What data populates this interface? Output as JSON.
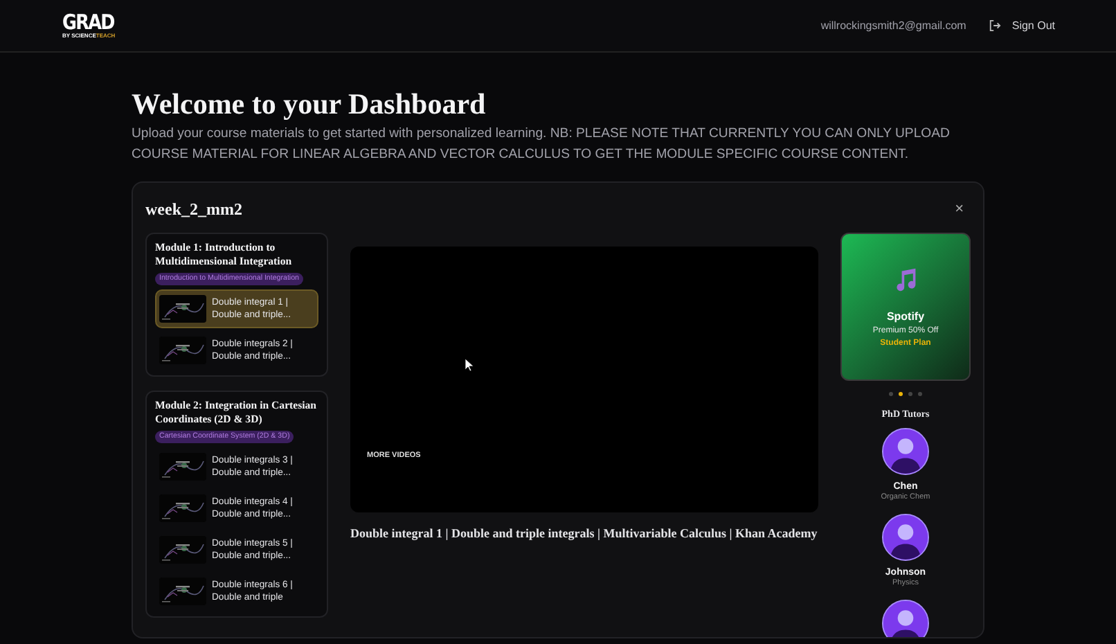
{
  "header": {
    "logo": "GRAD",
    "logo_sub_a": "BY SCIENCE",
    "logo_sub_b": "TEACH",
    "email": "willrockingsmith2@gmail.com",
    "sign_out": "Sign Out"
  },
  "page": {
    "title": "Welcome to your Dashboard",
    "description": "Upload your course materials to get started with personalized learning. NB: PLEASE NOTE THAT CURRENTLY YOU CAN ONLY UPLOAD COURSE MATERIAL FOR LINEAR ALGEBRA AND VECTOR CALCULUS TO GET THE MODULE SPECIFIC COURSE CONTENT."
  },
  "course": {
    "title": "week_2_mm2",
    "close": "×",
    "modules": [
      {
        "title": "Module 1: Introduction to Multidimensional Integration",
        "tag": "Introduction to Multidimensional Integration",
        "lessons": [
          {
            "title": "Double integral 1 | Double and triple...",
            "selected": true
          },
          {
            "title": "Double integrals 2 | Double and triple...",
            "selected": false
          }
        ]
      },
      {
        "title": "Module 2: Integration in Cartesian Coordinates (2D & 3D)",
        "tag": "Cartesian Coordinate System (2D & 3D)",
        "lessons": [
          {
            "title": "Double integrals 3 | Double and triple...",
            "selected": false
          },
          {
            "title": "Double integrals 4 | Double and triple...",
            "selected": false
          },
          {
            "title": "Double integrals 5 | Double and triple...",
            "selected": false
          },
          {
            "title": "Double integrals 6 | Double and triple",
            "selected": false
          }
        ]
      }
    ],
    "video": {
      "overlay": "MORE VIDEOS",
      "caption": "Double integral 1 | Double and triple integrals | Multivariable Calculus | Khan Academy"
    },
    "promo": {
      "brand": "Spotify",
      "offer": "Premium 50% Off",
      "plan": "Student Plan"
    },
    "dots": [
      {
        "selected": false
      },
      {
        "selected": true
      },
      {
        "selected": false
      },
      {
        "selected": false
      }
    ],
    "tutors_title": "PhD Tutors",
    "tutors": [
      {
        "kind": "named",
        "name": "Chen",
        "subject": "Organic Chem"
      },
      {
        "kind": "named",
        "name": "Johnson",
        "subject": "Physics"
      },
      {
        "kind": "avatar"
      }
    ]
  }
}
